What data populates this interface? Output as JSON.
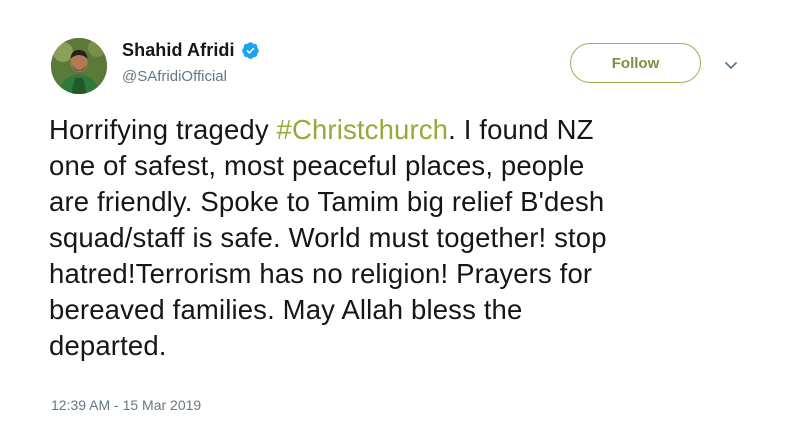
{
  "user": {
    "display_name": "Shahid Afridi",
    "handle": "@SAfridiOfficial",
    "verified": true
  },
  "follow_button": {
    "label": "Follow"
  },
  "tweet": {
    "lines": [
      [
        "Horrifying tragedy ",
        "#Christchurch",
        ". I found NZ"
      ],
      "one of safest, most peaceful places, people",
      "are friendly. Spoke to Tamim big relief B'desh",
      "squad/staff is safe. World must together! stop",
      "hatred!Terrorism has no religion! Prayers for",
      "bereaved families. May Allah bless the",
      "departed."
    ],
    "line1_pre": "Horrifying tragedy ",
    "hashtag": "#Christchurch",
    "line1_post": ". I found NZ",
    "line2": "one of safest, most peaceful places, people",
    "line3": "are friendly. Spoke to Tamim big relief B'desh",
    "line4": "squad/staff is safe. World must together! stop",
    "line5": "hatred!Terrorism has no religion! Prayers for",
    "line6": "bereaved families. May Allah bless the",
    "line7": "departed.",
    "timestamp": "12:39 AM - 15 Mar 2019"
  },
  "icons": {
    "avatar": "avatar",
    "verified": "verified-badge-icon",
    "more": "chevron-down-icon"
  },
  "colors": {
    "hashtag": "#9aa838",
    "follow_border": "#9bb25a",
    "verified_badge": "#1da1f2",
    "secondary_text": "#657786"
  }
}
